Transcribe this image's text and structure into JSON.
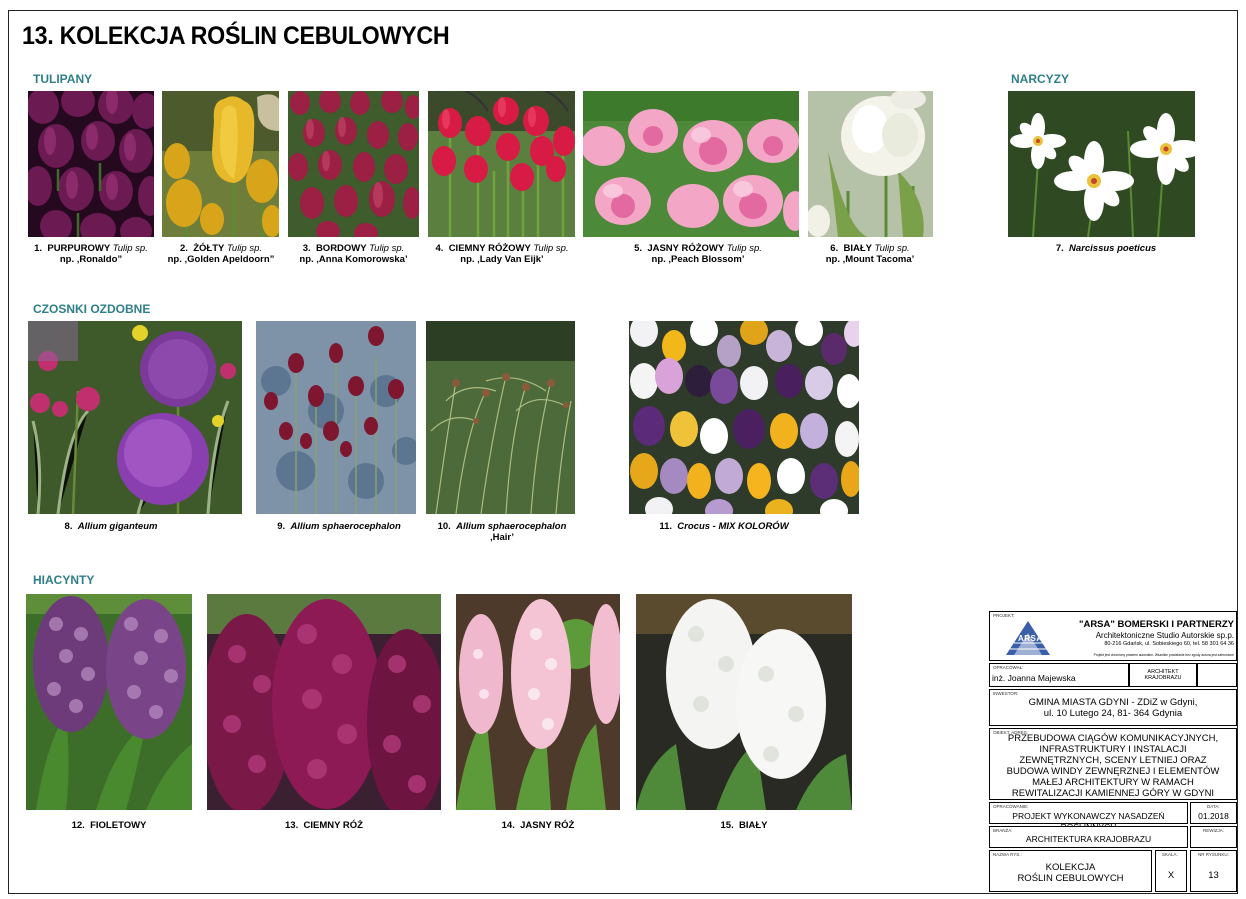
{
  "title": "13. KOLEKCJA ROŚLIN CEBULOWYCH",
  "sections": {
    "tulipany": "TULIPANY",
    "narcyzy": "NARCYZY",
    "czosnki": "CZOSNKI OZDOBNE",
    "hiacynty": "HIACYNTY"
  },
  "plants": [
    {
      "num": "1.",
      "name": "PURPUROWY",
      "latin": "Tulip sp.",
      "variety": "np. ‚Ronaldo”"
    },
    {
      "num": "2.",
      "name": "ŻÓŁTY",
      "latin": "Tulip sp.",
      "variety": "np. ‚Golden Apeldoorn”"
    },
    {
      "num": "3.",
      "name": "BORDOWY",
      "latin": "Tulip sp.",
      "variety": "np. ‚Anna Komorowska’"
    },
    {
      "num": "4.",
      "name": "CIEMNY RÓŻOWY",
      "latin": "Tulip sp.",
      "variety": "np. ‚Lady Van Eijk’"
    },
    {
      "num": "5.",
      "name": "JASNY RÓŻOWY",
      "latin": "Tulip sp.",
      "variety": "np. ‚Peach Blossom’"
    },
    {
      "num": "6.",
      "name": "BIAŁY",
      "latin": "Tulip sp.",
      "variety": "np. ‚Mount Tacoma’"
    },
    {
      "num": "7.",
      "latin": "Narcissus poeticus"
    },
    {
      "num": "8.",
      "latin": "Allium giganteum"
    },
    {
      "num": "9.",
      "latin": "Allium sphaerocephalon"
    },
    {
      "num": "10.",
      "latin": "Allium sphaerocephalon",
      "variety": "‚Hair’"
    },
    {
      "num": "11.",
      "latin": "Crocus - MIX KOLORÓW"
    },
    {
      "num": "12.",
      "name": "FIOLETOWY"
    },
    {
      "num": "13.",
      "name": "CIEMNY RÓŻ"
    },
    {
      "num": "14.",
      "name": "JASNY RÓŻ"
    },
    {
      "num": "15.",
      "name": "BIAŁY"
    }
  ],
  "titleblock": {
    "projekt_label": "PROJEKT:",
    "firm_name": "\"ARSA\" BOMERSKI I PARTNERZY",
    "firm_studio": "Architektoniczne Studio Autorskie sp.p.",
    "firm_address": "80-216 Gdańsk, ul. Sobieskiego 60, tel. 58 301 64 36",
    "copyright": "Projekt jest chroniony prawem autorskim. Wszelkie powielanie bez zgody autora jest zabronione",
    "logo_text": "ARSA",
    "opracowal_label": "OPRACOWAŁ:",
    "opracowal": "inż. Joanna Majewska",
    "architekt": "ARCHITEKT KRAJOBRAZU",
    "inwestor_label": "INWESTOR:",
    "inwestor_1": "GMINA MIASTA GDYNI - ZDiZ w Gdyni,",
    "inwestor_2": "ul. 10 Lutego 24, 81- 364 Gdynia",
    "obiekt_label": "OBIEKT, ADRES:",
    "obiekt_1": "PRZEBUDOWA CIĄGÓW KOMUNIKACYJNYCH,",
    "obiekt_2": "INFRASTRUKTURY I INSTALACJI",
    "obiekt_3": "ZEWNĘTRZNYCH, SCENY LETNIEJ ORAZ",
    "obiekt_4": "BUDOWA WINDY ZEWNĘRZNEJ I ELEMENTÓW",
    "obiekt_5": "MAŁEJ ARCHITEKTURY W RAMACH",
    "obiekt_6": "REWITALIZACJI KAMIENNEJ GÓRY W GDYNI",
    "opracowanie_label": "OPRACOWANIE:",
    "opracowanie": "PROJEKT WYKONAWCZY NASADZEŃ ROŚLINNYCH",
    "data_label": "DATA:",
    "data": "01.2018",
    "branza_label": "BRANŻA:",
    "branza": "ARCHITEKTURA KRAJOBRAZU",
    "rewizja_label": "REWIZJA:",
    "nazwa_label": "NAZWA RYS.:",
    "nazwa_1": "KOLEKCJA",
    "nazwa_2": "ROŚLIN CEBULOWYCH",
    "skala_label": "SKALA:",
    "skala": "X",
    "nr_label": "NR RYSUNKU:",
    "nr": "13"
  },
  "colors": {
    "section": "#2f7f8a",
    "logo_blue": "#3a5fa8"
  }
}
